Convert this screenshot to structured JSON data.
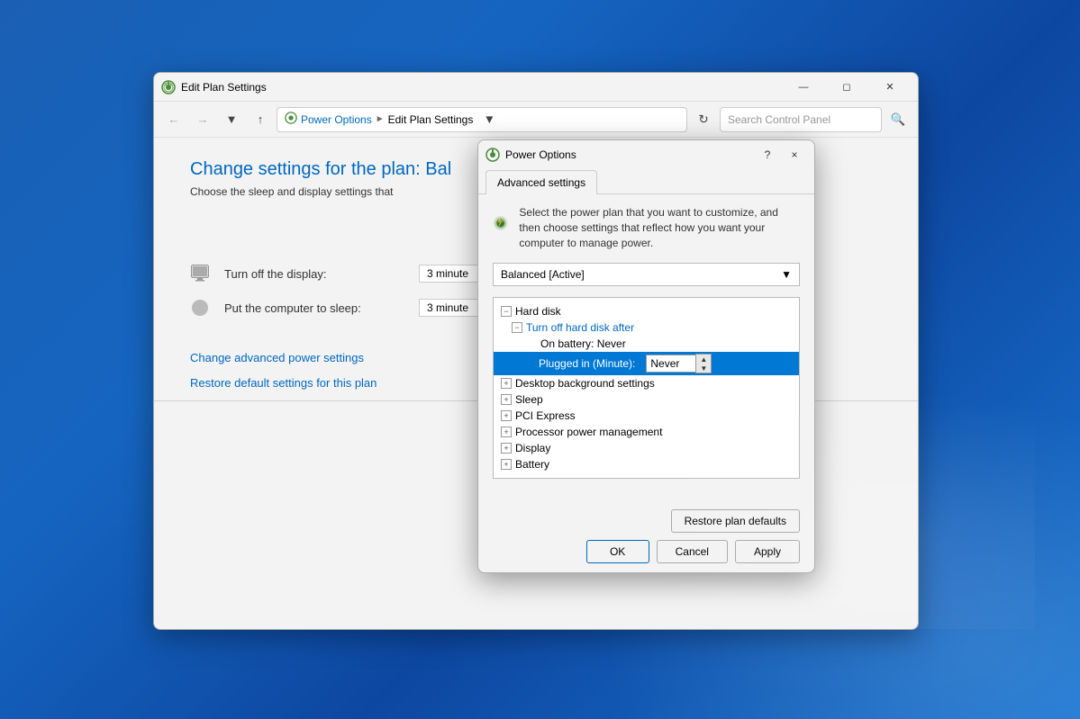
{
  "edit_plan_window": {
    "title": "Edit Plan Settings",
    "nav": {
      "back_disabled": true,
      "forward_disabled": true,
      "up_tooltip": "Up",
      "breadcrumb": {
        "icon": "power-options-icon",
        "parts": [
          "Power Options",
          "Edit Plan Settings"
        ]
      },
      "search_placeholder": "Search Control Panel"
    },
    "page_title": "Change settings for the plan: Bal",
    "page_subtitle": "Choose the sleep and display settings that",
    "settings": [
      {
        "label": "Turn off the display:",
        "value": "3 minute",
        "icon": "monitor-icon"
      },
      {
        "label": "Put the computer to sleep:",
        "value": "3 minute",
        "icon": "sleep-icon"
      }
    ],
    "links": [
      "Change advanced power settings",
      "Restore default settings for this plan"
    ]
  },
  "power_dialog": {
    "title": "Power Options",
    "tabs": [
      "Advanced settings"
    ],
    "description": "Select the power plan that you want to customize, and then choose settings that reflect how you want your computer to manage power.",
    "plan_dropdown": {
      "value": "Balanced [Active]"
    },
    "tree": {
      "items": [
        {
          "id": "hard-disk",
          "label": "Hard disk",
          "expand": "minus",
          "indent": 0,
          "children": [
            {
              "id": "turn-off-hard-disk",
              "label": "Turn off hard disk after",
              "expand": "minus",
              "indent": 1,
              "children": [
                {
                  "id": "on-battery",
                  "label": "On battery:",
                  "value": "Never",
                  "indent": 2,
                  "selected": false
                },
                {
                  "id": "plugged-in",
                  "label": "Plugged in (Minute):",
                  "value": "Never",
                  "indent": 2,
                  "selected": true,
                  "has_spinner": true
                }
              ]
            }
          ]
        },
        {
          "id": "desktop-background",
          "label": "Desktop background settings",
          "expand": "plus",
          "indent": 0
        },
        {
          "id": "sleep",
          "label": "Sleep",
          "expand": "plus",
          "indent": 0
        },
        {
          "id": "pci-express",
          "label": "PCI Express",
          "expand": "plus",
          "indent": 0
        },
        {
          "id": "processor-power",
          "label": "Processor power management",
          "expand": "plus",
          "indent": 0
        },
        {
          "id": "display",
          "label": "Display",
          "expand": "plus",
          "indent": 0
        },
        {
          "id": "battery",
          "label": "Battery",
          "expand": "plus",
          "indent": 0
        }
      ]
    },
    "buttons": {
      "restore_defaults": "Restore plan defaults",
      "ok": "OK",
      "cancel": "Cancel",
      "apply": "Apply"
    },
    "close_btn": "×",
    "help_btn": "?"
  }
}
